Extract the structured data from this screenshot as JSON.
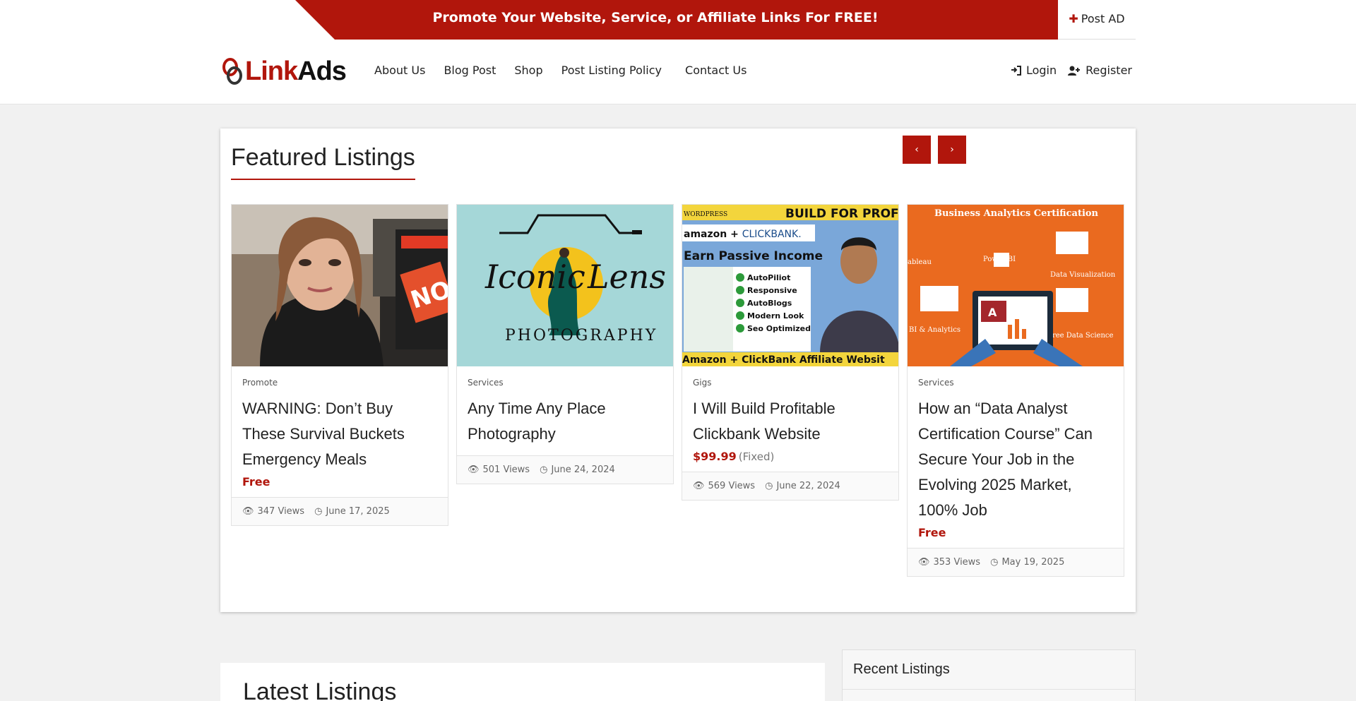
{
  "promo": {
    "text": "Promote Your Website, Service, or Affiliate Links For FREE!",
    "post_ad_label": "Post AD"
  },
  "brand": {
    "logo_part1": "Link",
    "logo_part2": "Ads",
    "accent": "#b1160c"
  },
  "nav": {
    "items": [
      "About Us",
      "Blog Post",
      "Shop",
      "Post Listing Policy",
      "Contact Us"
    ]
  },
  "auth": {
    "login_label": "Login",
    "register_label": "Register"
  },
  "featured": {
    "title": "Featured Listings",
    "prev_label": "‹",
    "next_label": "›",
    "cards": [
      {
        "category": "Promote",
        "title": "WARNING: Don’t Buy These Survival Buckets Emergency Meals",
        "price": "Free",
        "price_note": "",
        "views": "347 Views",
        "date": "June 17, 2025"
      },
      {
        "category": "Services",
        "title": "Any Time Any Place Photography",
        "price": "",
        "price_note": "",
        "views": "501 Views",
        "date": "June 24, 2024",
        "image_text": {
          "word1": "Iconic",
          "word2": "Lens",
          "arc": "PHOTOGRAPHY"
        }
      },
      {
        "category": "Gigs",
        "title": "I Will Build Profitable Clickbank Website",
        "price": "$99.99",
        "price_note": "(Fixed)",
        "views": "569 Views",
        "date": "June 22, 2024",
        "image_text": {
          "top_left": "WORDPRESS",
          "top_right": "BUILD FOR PROFI",
          "brand_a": "amazon + ",
          "brand_b": "CLICKBANK.",
          "headline": "Earn Passive Income",
          "features": [
            "AutoPiliot",
            "Responsive",
            "AutoBlogs",
            "Modern Look",
            "Seo Optimized"
          ],
          "footer": "Amazon + ClickBank Affiliate Websit"
        }
      },
      {
        "category": "Services",
        "title": "How an “Data Analyst Certification Course” Can Secure Your Job in the Evolving 2025 Market, 100% Job",
        "price": "Free",
        "price_note": "",
        "views": "353 Views",
        "date": "May 19, 2025",
        "image_text": {
          "heading": "Business Analytics Certification",
          "labels": [
            "Power BI",
            "Data Visualization",
            "ableau",
            "BI & Analytics",
            "Free Data Science"
          ]
        }
      }
    ]
  },
  "latest": {
    "title": "Latest Listings"
  },
  "recent": {
    "title": "Recent Listings"
  }
}
